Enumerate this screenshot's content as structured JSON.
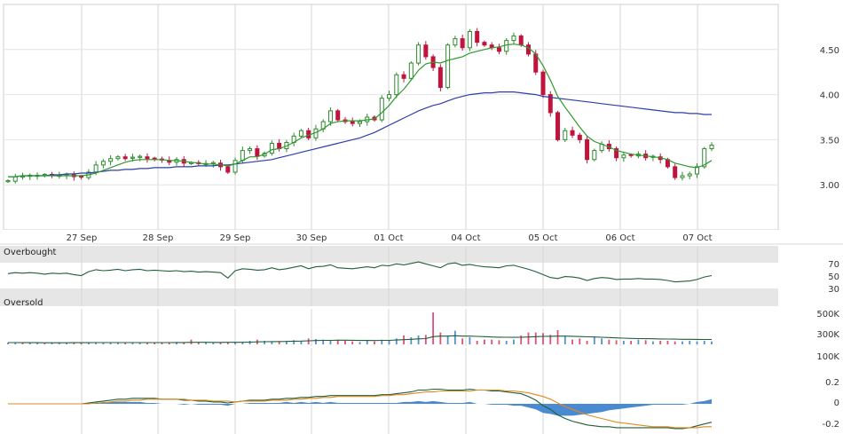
{
  "chart_data": {
    "type": "candlestick",
    "x_tick_labels": [
      "27 Sep",
      "28 Sep",
      "29 Sep",
      "30 Sep",
      "01 Oct",
      "04 Oct",
      "05 Oct",
      "06 Oct",
      "07 Oct"
    ],
    "price": {
      "yticks": [
        3.0,
        3.5,
        4.0,
        4.5
      ],
      "ytick_labels": [
        "3.00",
        "3.50",
        "4.00",
        "4.50"
      ],
      "ylim": [
        2.5,
        5.0
      ],
      "up_color": "#2e8b2e",
      "down_color": "#c0143c",
      "sma_short_color": "#2e9a2e",
      "sma_long_color": "#2d3fa8",
      "closes": [
        3.04,
        3.09,
        3.09,
        3.1,
        3.1,
        3.11,
        3.1,
        3.1,
        3.11,
        3.09,
        3.08,
        3.14,
        3.22,
        3.26,
        3.29,
        3.31,
        3.29,
        3.3,
        3.31,
        3.29,
        3.28,
        3.27,
        3.25,
        3.28,
        3.24,
        3.24,
        3.23,
        3.23,
        3.24,
        3.2,
        3.14,
        3.27,
        3.38,
        3.4,
        3.32,
        3.35,
        3.46,
        3.4,
        3.47,
        3.54,
        3.6,
        3.52,
        3.62,
        3.7,
        3.82,
        3.72,
        3.7,
        3.68,
        3.7,
        3.75,
        3.72,
        3.96,
        4.0,
        4.22,
        4.18,
        4.35,
        4.55,
        4.42,
        4.3,
        4.08,
        4.55,
        4.62,
        4.52,
        4.7,
        4.58,
        4.55,
        4.52,
        4.48,
        4.6,
        4.65,
        4.55,
        4.45,
        4.25,
        4.0,
        3.8,
        3.5,
        3.6,
        3.55,
        3.5,
        3.28,
        3.38,
        3.45,
        3.4,
        3.3,
        3.33,
        3.32,
        3.34,
        3.3,
        3.31,
        3.28,
        3.2,
        3.08,
        3.1,
        3.12,
        3.2,
        3.4,
        3.44
      ],
      "sma_short": [
        3.09,
        3.09,
        3.1,
        3.1,
        3.1,
        3.1,
        3.1,
        3.1,
        3.1,
        3.1,
        3.1,
        3.11,
        3.13,
        3.16,
        3.19,
        3.22,
        3.25,
        3.27,
        3.28,
        3.28,
        3.28,
        3.28,
        3.27,
        3.27,
        3.26,
        3.25,
        3.24,
        3.23,
        3.23,
        3.22,
        3.21,
        3.23,
        3.27,
        3.31,
        3.31,
        3.34,
        3.39,
        3.4,
        3.43,
        3.47,
        3.52,
        3.55,
        3.58,
        3.62,
        3.68,
        3.7,
        3.71,
        3.71,
        3.71,
        3.72,
        3.73,
        3.8,
        3.88,
        3.98,
        4.06,
        4.16,
        4.27,
        4.34,
        4.36,
        4.35,
        4.38,
        4.4,
        4.42,
        4.46,
        4.48,
        4.5,
        4.52,
        4.53,
        4.55,
        4.56,
        4.55,
        4.52,
        4.45,
        4.32,
        4.16,
        3.98,
        3.86,
        3.75,
        3.64,
        3.54,
        3.48,
        3.45,
        3.42,
        3.38,
        3.36,
        3.34,
        3.33,
        3.32,
        3.31,
        3.3,
        3.28,
        3.24,
        3.22,
        3.2,
        3.19,
        3.22,
        3.27
      ],
      "sma_long": [
        3.09,
        3.09,
        3.1,
        3.1,
        3.1,
        3.1,
        3.11,
        3.11,
        3.12,
        3.12,
        3.13,
        3.13,
        3.14,
        3.15,
        3.16,
        3.16,
        3.17,
        3.17,
        3.18,
        3.18,
        3.19,
        3.19,
        3.19,
        3.2,
        3.2,
        3.2,
        3.21,
        3.21,
        3.21,
        3.22,
        3.22,
        3.23,
        3.24,
        3.25,
        3.26,
        3.27,
        3.28,
        3.3,
        3.32,
        3.34,
        3.36,
        3.38,
        3.4,
        3.42,
        3.44,
        3.46,
        3.48,
        3.5,
        3.52,
        3.55,
        3.58,
        3.62,
        3.66,
        3.7,
        3.74,
        3.78,
        3.82,
        3.85,
        3.88,
        3.9,
        3.93,
        3.96,
        3.98,
        4.0,
        4.01,
        4.02,
        4.02,
        4.03,
        4.03,
        4.03,
        4.02,
        4.01,
        4.0,
        3.98,
        3.97,
        3.96,
        3.95,
        3.94,
        3.93,
        3.92,
        3.91,
        3.9,
        3.89,
        3.88,
        3.87,
        3.86,
        3.85,
        3.84,
        3.83,
        3.82,
        3.81,
        3.8,
        3.8,
        3.79,
        3.79,
        3.78,
        3.78
      ]
    },
    "rsi": {
      "band_top_label": "Overbought",
      "band_bottom_label": "Oversold",
      "yticks": [
        70,
        50,
        30
      ],
      "ytick_labels": [
        "70",
        "50",
        "30"
      ],
      "ylim": [
        0,
        100
      ],
      "color": "#1f5f3a",
      "values": [
        54,
        56,
        55,
        56,
        55,
        53,
        55,
        54,
        55,
        52,
        50,
        58,
        62,
        60,
        61,
        63,
        60,
        62,
        63,
        60,
        61,
        60,
        59,
        60,
        58,
        59,
        57,
        58,
        57,
        56,
        45,
        60,
        64,
        63,
        61,
        62,
        66,
        62,
        64,
        67,
        70,
        64,
        68,
        69,
        72,
        66,
        65,
        64,
        66,
        68,
        66,
        71,
        70,
        74,
        72,
        75,
        78,
        74,
        70,
        66,
        74,
        76,
        71,
        73,
        70,
        68,
        67,
        66,
        70,
        71,
        67,
        63,
        58,
        52,
        46,
        44,
        48,
        47,
        45,
        40,
        44,
        46,
        45,
        42,
        43,
        43,
        44,
        43,
        43,
        42,
        40,
        37,
        38,
        39,
        42,
        47,
        50
      ]
    },
    "volume": {
      "yticks": [
        500000,
        300000,
        100000
      ],
      "ytick_labels": [
        "500K",
        "300K",
        "100K"
      ],
      "ylim": [
        0,
        600000
      ],
      "up_color": "#5b8fd1",
      "down_color": "#e05078",
      "avg_color": "#1f5f3a",
      "values": [
        30000,
        30000,
        25000,
        30000,
        25000,
        20000,
        30000,
        25000,
        25000,
        30000,
        35000,
        30000,
        35000,
        30000,
        25000,
        30000,
        30000,
        25000,
        30000,
        30000,
        30000,
        35000,
        30000,
        40000,
        30000,
        80000,
        30000,
        30000,
        25000,
        30000,
        35000,
        40000,
        30000,
        60000,
        80000,
        60000,
        40000,
        50000,
        60000,
        70000,
        50000,
        100000,
        90000,
        80000,
        70000,
        80000,
        60000,
        50000,
        40000,
        60000,
        50000,
        80000,
        60000,
        100000,
        150000,
        120000,
        150000,
        160000,
        540000,
        200000,
        150000,
        230000,
        100000,
        120000,
        60000,
        80000,
        80000,
        70000,
        60000,
        80000,
        150000,
        200000,
        200000,
        190000,
        160000,
        240000,
        140000,
        80000,
        100000,
        60000,
        120000,
        100000,
        80000,
        70000,
        60000,
        60000,
        80000,
        70000,
        50000,
        60000,
        60000,
        50000,
        50000,
        60000,
        50000,
        60000,
        50000
      ],
      "up_flags": [
        1,
        1,
        0,
        1,
        1,
        0,
        1,
        1,
        1,
        0,
        0,
        1,
        1,
        1,
        1,
        1,
        0,
        1,
        1,
        0,
        0,
        0,
        0,
        1,
        0,
        0,
        0,
        1,
        1,
        0,
        0,
        1,
        1,
        1,
        0,
        1,
        1,
        0,
        1,
        1,
        1,
        0,
        1,
        1,
        1,
        0,
        0,
        0,
        1,
        1,
        0,
        1,
        1,
        1,
        0,
        1,
        1,
        0,
        0,
        0,
        1,
        1,
        0,
        1,
        0,
        0,
        0,
        0,
        1,
        1,
        0,
        0,
        0,
        0,
        0,
        0,
        1,
        0,
        0,
        0,
        1,
        1,
        0,
        0,
        1,
        0,
        1,
        0,
        1,
        0,
        0,
        0,
        1,
        1,
        1,
        1,
        1
      ],
      "avg": [
        30000,
        30000,
        29000,
        29000,
        28000,
        27000,
        27000,
        27000,
        27000,
        28000,
        28000,
        29000,
        30000,
        30000,
        30000,
        30000,
        30000,
        30000,
        30000,
        30000,
        30000,
        30000,
        30000,
        31000,
        31000,
        34000,
        34000,
        34000,
        33000,
        33000,
        34000,
        35000,
        35000,
        38000,
        42000,
        45000,
        46000,
        48000,
        50000,
        54000,
        55000,
        60000,
        64000,
        67000,
        68000,
        70000,
        70000,
        69000,
        66000,
        66000,
        64000,
        67000,
        68000,
        73000,
        80000,
        86000,
        93000,
        98000,
        130000,
        140000,
        140000,
        145000,
        140000,
        140000,
        135000,
        130000,
        125000,
        122000,
        120000,
        118000,
        120000,
        125000,
        130000,
        135000,
        136000,
        140000,
        140000,
        136000,
        132000,
        128000,
        125000,
        120000,
        115000,
        110000,
        105000,
        100000,
        98000,
        96000,
        94000,
        92000,
        90000,
        88000,
        86000,
        85000,
        84000,
        83000,
        82000
      ]
    },
    "macd": {
      "yticks": [
        0.2,
        0,
        -0.2
      ],
      "ytick_labels": [
        "0.2",
        "0",
        "-0.2"
      ],
      "ylim": [
        -0.3,
        0.3
      ],
      "macd_color": "#1f5f3a",
      "signal_color": "#e08a1e",
      "hist_color": "#4a8ad0",
      "macd": [
        0,
        0,
        0,
        0,
        0,
        0,
        0,
        0,
        0,
        0,
        0,
        0.01,
        0.02,
        0.03,
        0.04,
        0.05,
        0.05,
        0.06,
        0.06,
        0.06,
        0.06,
        0.05,
        0.05,
        0.05,
        0.04,
        0.04,
        0.03,
        0.03,
        0.02,
        0.02,
        0.01,
        0.02,
        0.03,
        0.04,
        0.04,
        0.04,
        0.05,
        0.05,
        0.06,
        0.06,
        0.07,
        0.07,
        0.08,
        0.08,
        0.09,
        0.09,
        0.09,
        0.09,
        0.09,
        0.09,
        0.09,
        0.1,
        0.1,
        0.11,
        0.12,
        0.13,
        0.15,
        0.15,
        0.16,
        0.16,
        0.15,
        0.15,
        0.15,
        0.16,
        0.15,
        0.15,
        0.14,
        0.14,
        0.13,
        0.12,
        0.11,
        0.08,
        0.04,
        -0.02,
        -0.06,
        -0.12,
        -0.16,
        -0.19,
        -0.21,
        -0.23,
        -0.24,
        -0.25,
        -0.25,
        -0.26,
        -0.26,
        -0.26,
        -0.26,
        -0.26,
        -0.26,
        -0.26,
        -0.26,
        -0.27,
        -0.27,
        -0.26,
        -0.24,
        -0.22,
        -0.2
      ],
      "signal": [
        0,
        0,
        0,
        0,
        0,
        0,
        0,
        0,
        0,
        0,
        0,
        0,
        0.01,
        0.01,
        0.02,
        0.03,
        0.03,
        0.04,
        0.04,
        0.05,
        0.05,
        0.05,
        0.05,
        0.05,
        0.05,
        0.04,
        0.04,
        0.04,
        0.03,
        0.03,
        0.03,
        0.02,
        0.03,
        0.03,
        0.03,
        0.03,
        0.04,
        0.04,
        0.04,
        0.05,
        0.05,
        0.06,
        0.06,
        0.07,
        0.07,
        0.08,
        0.08,
        0.08,
        0.08,
        0.08,
        0.08,
        0.09,
        0.09,
        0.1,
        0.1,
        0.11,
        0.12,
        0.13,
        0.13,
        0.14,
        0.14,
        0.14,
        0.14,
        0.14,
        0.15,
        0.15,
        0.15,
        0.15,
        0.14,
        0.14,
        0.13,
        0.12,
        0.1,
        0.08,
        0.05,
        0.01,
        -0.03,
        -0.06,
        -0.09,
        -0.12,
        -0.14,
        -0.16,
        -0.18,
        -0.2,
        -0.21,
        -0.22,
        -0.23,
        -0.24,
        -0.25,
        -0.25,
        -0.25,
        -0.26,
        -0.26,
        -0.26,
        -0.26,
        -0.25,
        -0.25
      ]
    }
  }
}
